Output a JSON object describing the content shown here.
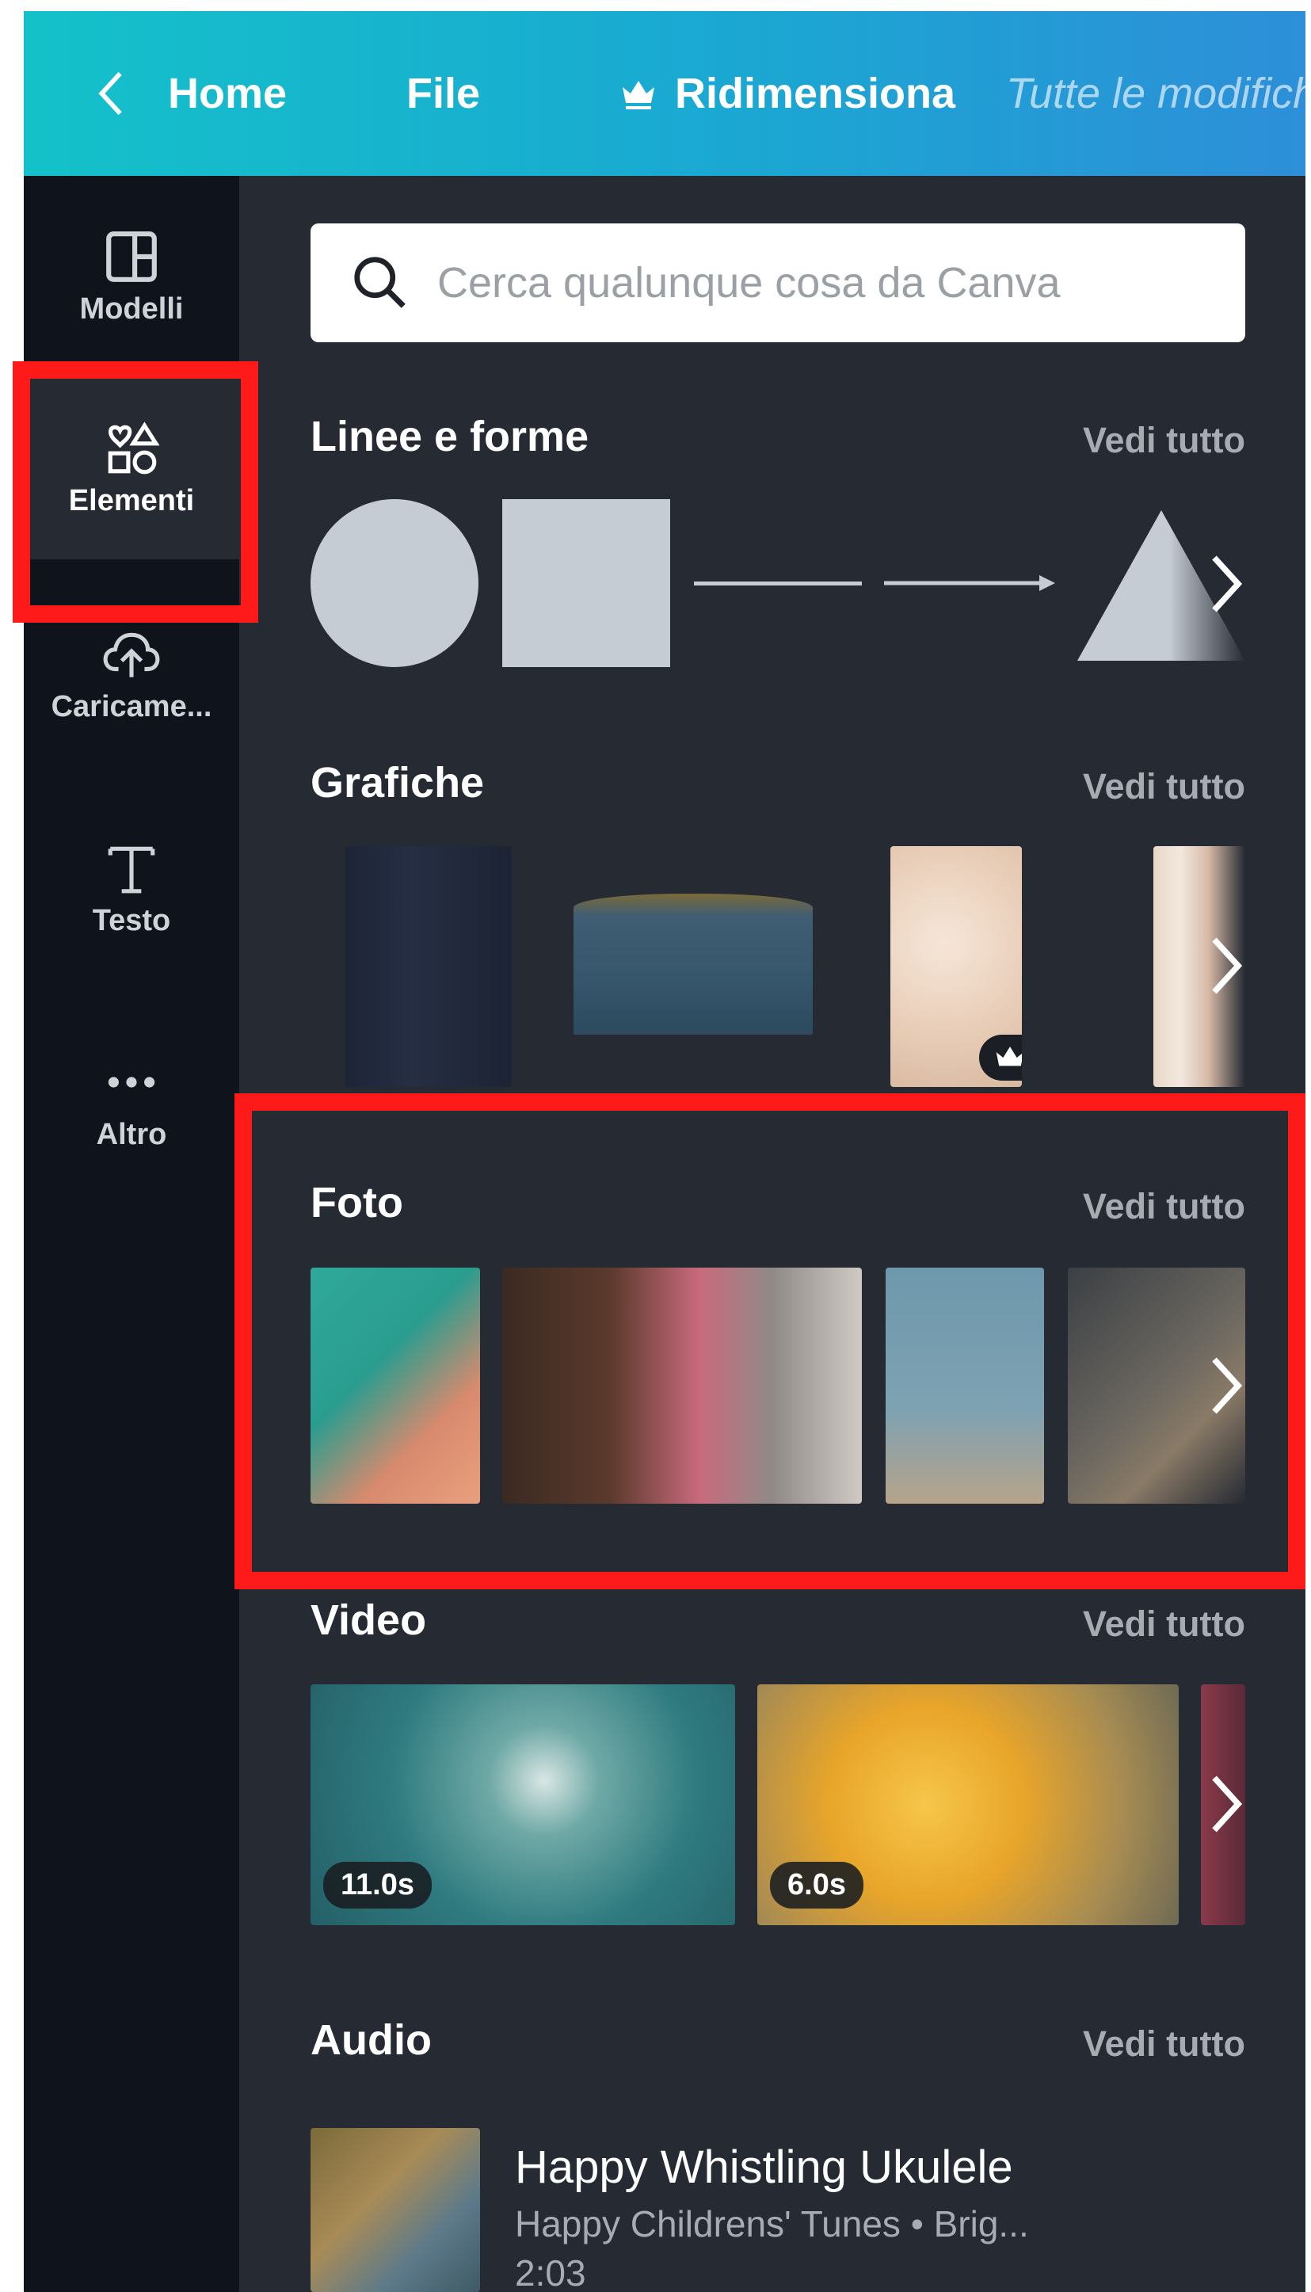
{
  "topbar": {
    "home": "Home",
    "file": "File",
    "resize": "Ridimensiona",
    "status": "Tutte le modifiche"
  },
  "rail": [
    {
      "label": "Modelli",
      "icon": "layout-icon"
    },
    {
      "label": "Elementi",
      "icon": "shapes-icon"
    },
    {
      "label": "Caricame...",
      "icon": "cloud-upload-icon"
    },
    {
      "label": "Testo",
      "icon": "text-icon"
    },
    {
      "label": "Altro",
      "icon": "more-dots-icon"
    }
  ],
  "search": {
    "placeholder": "Cerca qualunque cosa da Canva"
  },
  "sections": {
    "lines": {
      "title": "Linee e forme",
      "more": "Vedi tutto"
    },
    "graphics": {
      "title": "Grafiche",
      "more": "Vedi tutto"
    },
    "photos": {
      "title": "Foto",
      "more": "Vedi tutto"
    },
    "videos": {
      "title": "Video",
      "more": "Vedi tutto",
      "durations": [
        "11.0s",
        "6.0s"
      ]
    },
    "audio": {
      "title": "Audio",
      "more": "Vedi tutto"
    }
  },
  "audio_item": {
    "title": "Happy Whistling Ukulele",
    "subtitle": "Happy Childrens' Tunes • Brig...",
    "duration": "2:03"
  },
  "colors": {
    "highlight": "#ff1a1a",
    "panel": "#252a33",
    "rail": "#0f141c"
  }
}
